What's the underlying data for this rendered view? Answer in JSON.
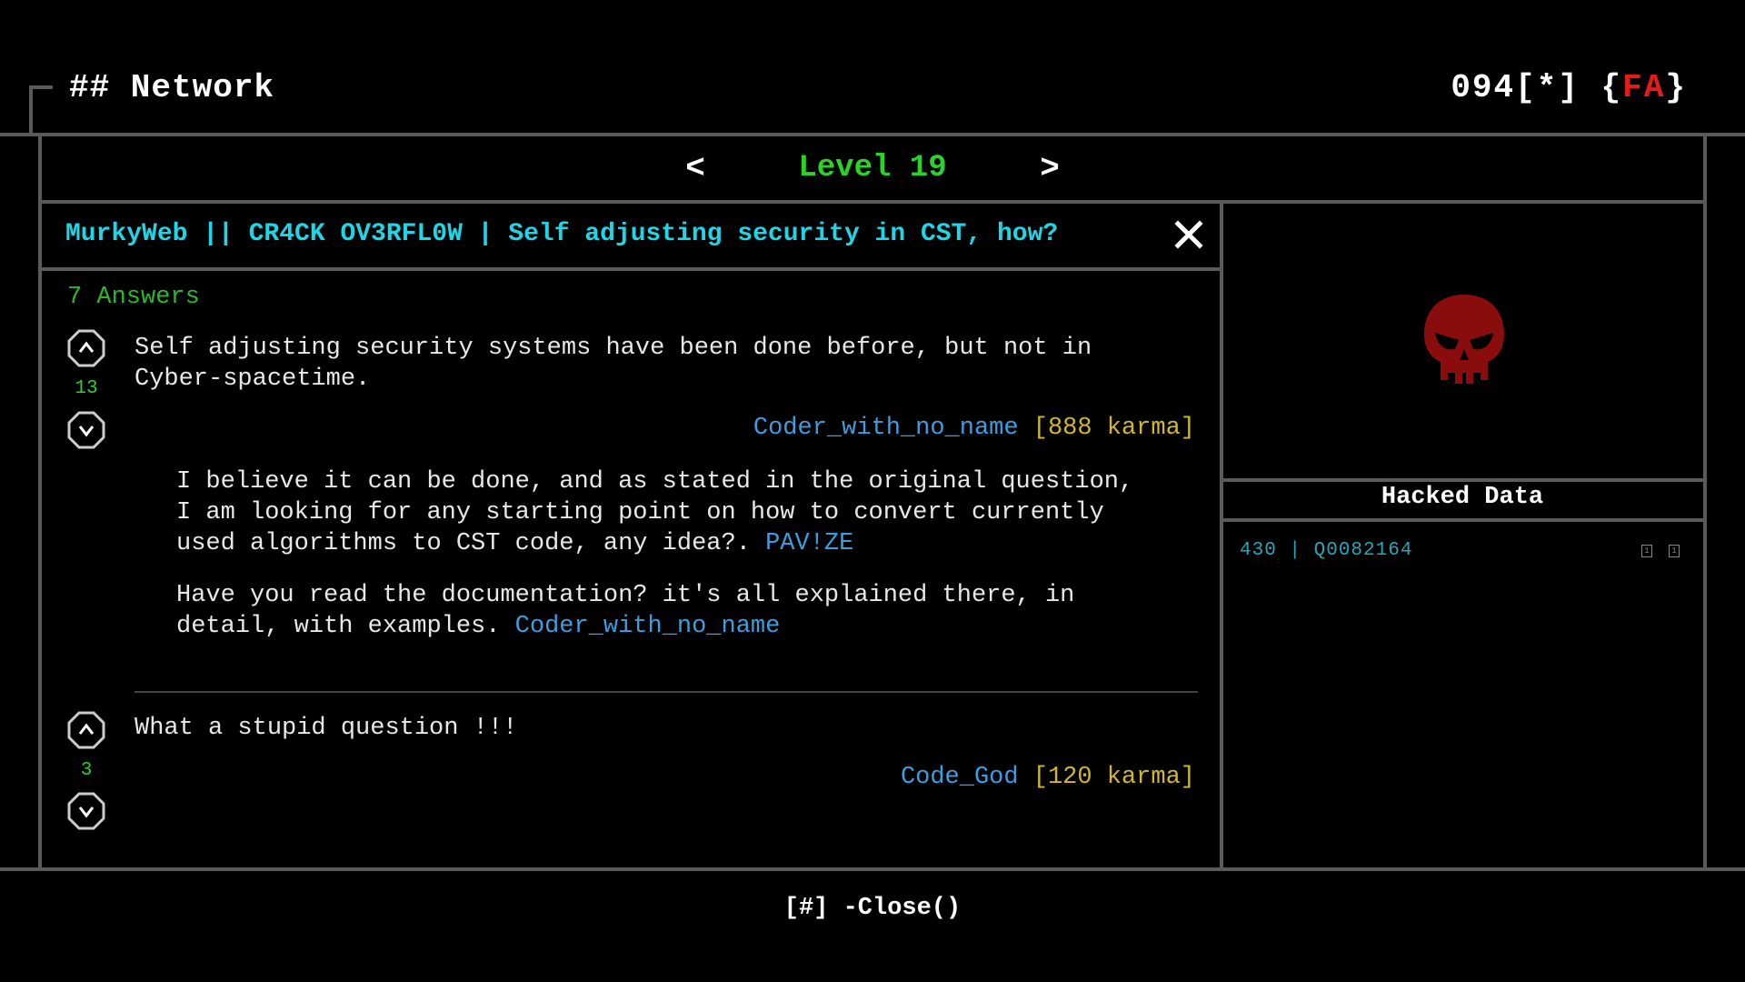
{
  "header": {
    "title": "## Network",
    "status_count": "094",
    "status_mid": "[*] {",
    "status_fa": "FA",
    "status_end": "}"
  },
  "level": {
    "prev": "<",
    "label": "Level 19",
    "next": ">"
  },
  "thread": {
    "title": "MurkyWeb || CR4CK OV3RFL0W | Self adjusting security in CST, how?",
    "answers_count": "7 Answers",
    "answers": [
      {
        "votes": "13",
        "text": "Self adjusting security systems have been done before, but not in\nCyber-spacetime.",
        "author": "Coder_with_no_name",
        "karma": "[888 karma]",
        "comments": [
          {
            "text": "I believe it can be done, and as stated in the original question,\nI am looking for any starting point on how to convert currently\nused algorithms to CST code, any idea?.",
            "author": "PAV!ZE"
          },
          {
            "text": "Have you read the documentation? it's all explained there, in\ndetail, with examples.",
            "author": "Coder_with_no_name"
          }
        ]
      },
      {
        "votes": "3",
        "text": "What a stupid question !!!",
        "author": "Code_God",
        "karma": "[120 karma]"
      }
    ]
  },
  "sidebar": {
    "icon": "skull-icon",
    "hacked_title": "Hacked Data",
    "hacked_row": "430 | Q0082164"
  },
  "footer": {
    "close_label": "[#] -Close()"
  },
  "colors": {
    "level": "#29d329",
    "title": "#1fd6e6",
    "author": "#3a9ee0",
    "karma": "#d4b823",
    "skull": "#8a0d0d",
    "alert": "#e31b1b"
  }
}
